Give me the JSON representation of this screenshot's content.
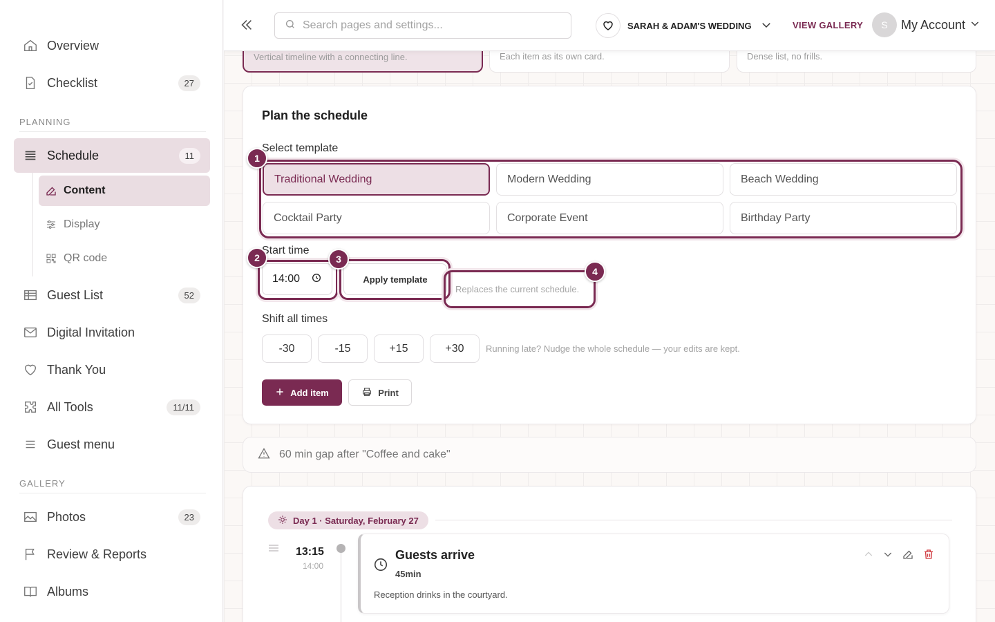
{
  "sidebar": {
    "overview": "Overview",
    "checklist": {
      "label": "Checklist",
      "count": "27"
    },
    "planning_head": "PLANNING",
    "schedule": {
      "label": "Schedule",
      "count": "11"
    },
    "sub": {
      "content": "Content",
      "display": "Display",
      "qr": "QR code"
    },
    "guest_list": {
      "label": "Guest List",
      "count": "52"
    },
    "digital_invitation": "Digital Invitation",
    "thank_you": "Thank You",
    "all_tools": {
      "label": "All Tools",
      "count": "11/11"
    },
    "guest_menu": "Guest menu",
    "gallery_head": "GALLERY",
    "photos": {
      "label": "Photos",
      "count": "23"
    },
    "review": "Review & Reports",
    "albums": "Albums"
  },
  "header": {
    "search_placeholder": "Search pages and settings...",
    "event_name": "SARAH & ADAM'S WEDDING",
    "view_gallery": "VIEW GALLERY",
    "avatar_initial": "S",
    "account": "My Account"
  },
  "layouts": {
    "timeline": "Vertical timeline with a connecting line.",
    "cards": "Each item as its own card.",
    "list": "Dense list, no frills."
  },
  "plan": {
    "title": "Plan the schedule",
    "select_template_label": "Select template",
    "templates": [
      "Traditional Wedding",
      "Modern Wedding",
      "Beach Wedding",
      "Cocktail Party",
      "Corporate Event",
      "Birthday Party"
    ],
    "selected_template": "Traditional Wedding",
    "start_time_label": "Start time",
    "start_time": "14:00",
    "apply_label": "Apply template",
    "apply_note": "Replaces the current schedule.",
    "shift_label": "Shift all times",
    "shifts": [
      "-30",
      "-15",
      "+15",
      "+30"
    ],
    "shift_hint": "Running late? Nudge the whole schedule — your edits are kept.",
    "add_item": "Add item",
    "print": "Print"
  },
  "markers": [
    "1",
    "2",
    "3",
    "4"
  ],
  "gap_warning": "60 min gap after \"Coffee and cake\"",
  "schedule": {
    "day_label": "Day 1 · Saturday, February 27",
    "items": [
      {
        "time": "13:15",
        "original_time": "14:00",
        "title": "Guests arrive",
        "duration": "45min",
        "description": "Reception drinks in the courtyard."
      }
    ]
  },
  "colors": {
    "accent": "#7a2a52",
    "accent_light": "#eddfe5"
  }
}
